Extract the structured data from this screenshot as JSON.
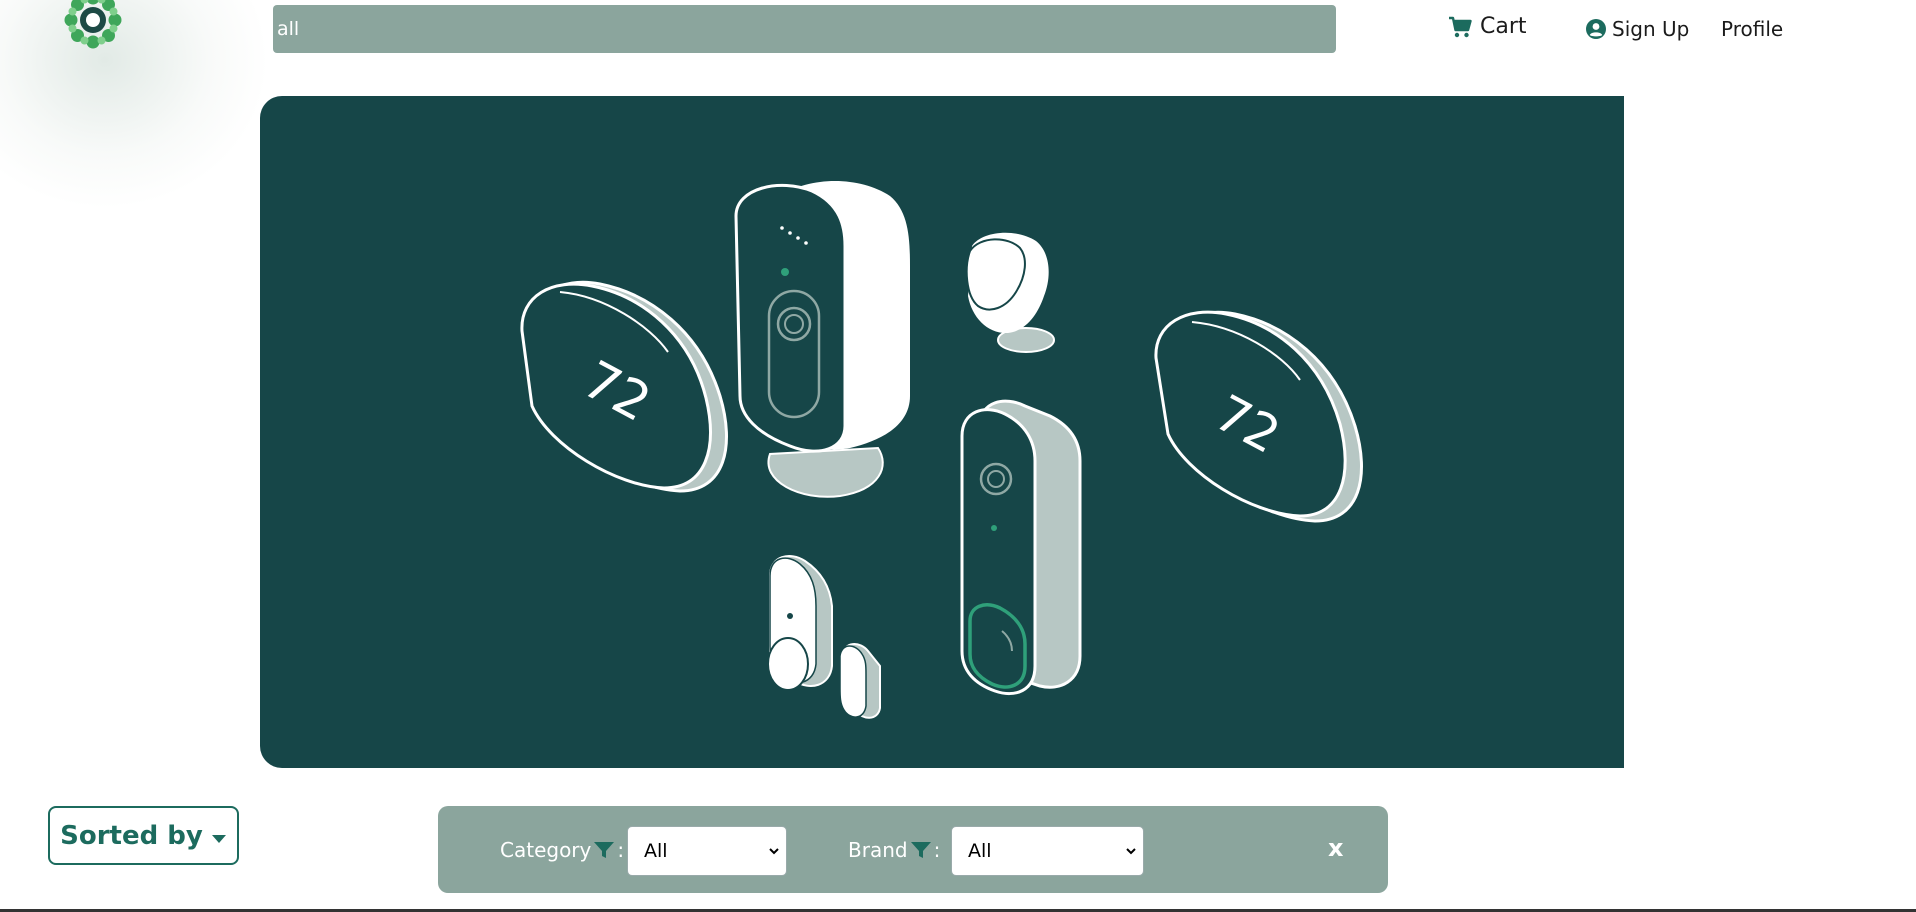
{
  "header": {
    "search": {
      "value": "all"
    },
    "nav": {
      "cart_label": "Cart",
      "signup_label": "Sign Up",
      "profile_label": "Profile"
    }
  },
  "hero": {
    "background_color": "#164648",
    "thermostat_display_left": "72",
    "thermostat_display_right": "72"
  },
  "sort": {
    "label": "Sorted by"
  },
  "filters": {
    "category_label": "Category",
    "category_value": "All",
    "brand_label": "Brand",
    "brand_value": "All",
    "clear_label": "x"
  },
  "colors": {
    "accent": "#1c6b5e",
    "bar": "#8ba59d",
    "hero_bg": "#164648"
  },
  "icons": [
    "logo-icon",
    "cart-icon",
    "user-circle-icon",
    "caret-down-icon",
    "filter-icon",
    "chevron-down-icon"
  ]
}
